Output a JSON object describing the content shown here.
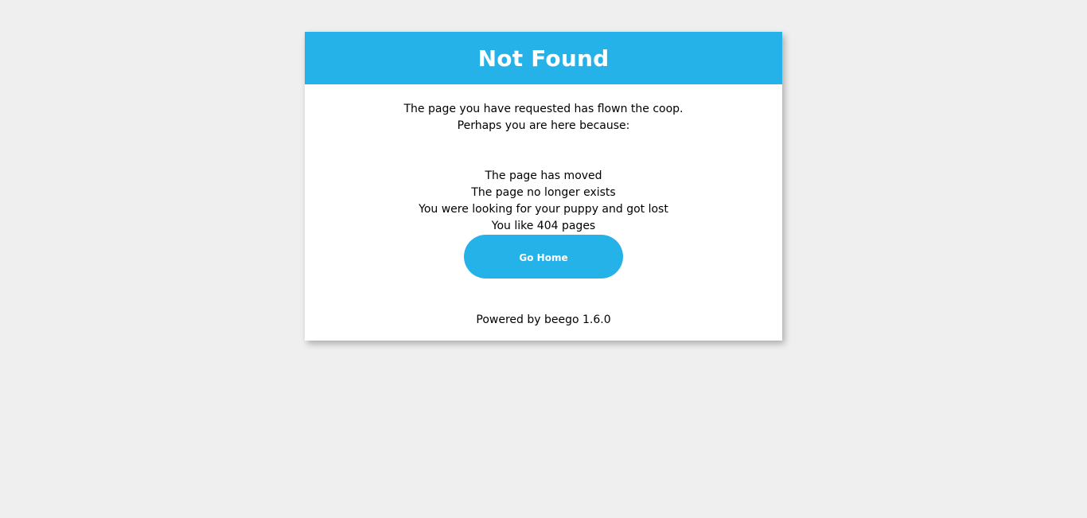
{
  "header": {
    "title": "Not Found"
  },
  "intro": {
    "line1": "The page you have requested has flown the coop.",
    "line2": "Perhaps you are here because:"
  },
  "reasons": [
    "The page has moved",
    "The page no longer exists",
    "You were looking for your puppy and got lost",
    "You like 404 pages"
  ],
  "home_button": {
    "label": "Go Home"
  },
  "footer": {
    "text": "Powered by beego 1.6.0"
  },
  "colors": {
    "accent": "#24b2e8",
    "background": "#efefef",
    "card": "#ffffff"
  }
}
